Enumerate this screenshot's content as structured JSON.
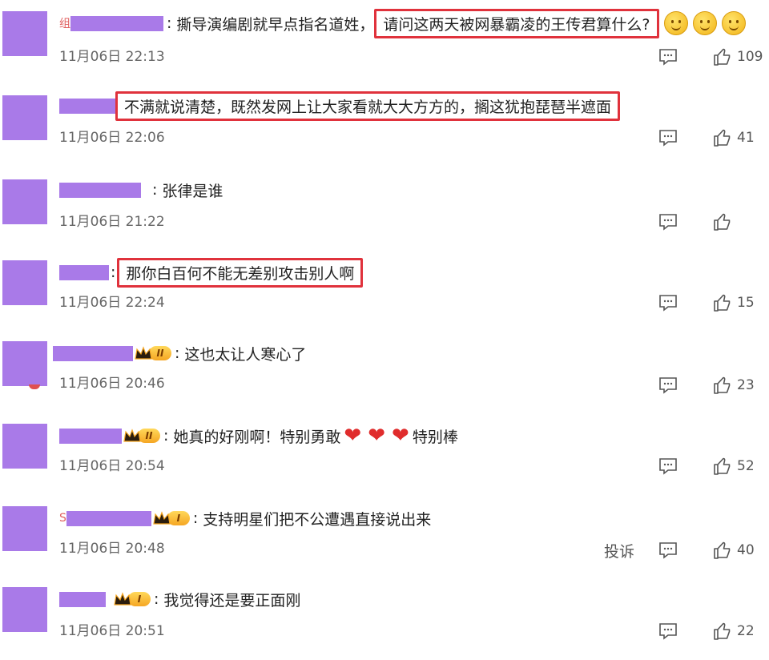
{
  "comments": [
    {
      "pre_text": "撕导演编剧就早点指名道姓，",
      "highlight_text": "请问这两天被网暴霸凌的王传君算什么?",
      "post_text": "",
      "name_fringe": "组",
      "badge_level": "",
      "time": "11月06日 22:13",
      "like_count": "109",
      "report_label": ""
    },
    {
      "pre_text": "",
      "highlight_text": "不满就说清楚，既然发网上让大家看就大大方方的，搁这犹抱琵琶半遮面",
      "post_text": "",
      "name_fringe": "",
      "badge_level": "",
      "time": "11月06日 22:06",
      "like_count": "41",
      "report_label": ""
    },
    {
      "pre_text": "张律是谁",
      "highlight_text": "",
      "post_text": "",
      "name_fringe": "",
      "badge_level": "",
      "time": "11月06日 21:22",
      "like_count": "",
      "report_label": ""
    },
    {
      "pre_text": "",
      "highlight_text": "那你白百何不能无差别攻击别人啊",
      "post_text": "",
      "name_fringe": "",
      "badge_level": "",
      "time": "11月06日 22:24",
      "like_count": "15",
      "report_label": ""
    },
    {
      "pre_text": "这也太让人寒心了",
      "highlight_text": "",
      "post_text": "",
      "name_fringe": "",
      "badge_level": "II",
      "time": "11月06日 20:46",
      "like_count": "23",
      "report_label": ""
    },
    {
      "pre_text": "她真的好刚啊！特别勇敢",
      "highlight_text": "",
      "post_text": "特别棒",
      "name_fringe": "",
      "badge_level": "II",
      "time": "11月06日 20:54",
      "like_count": "52",
      "report_label": ""
    },
    {
      "pre_text": "支持明星们把不公遭遇直接说出来",
      "highlight_text": "",
      "post_text": "",
      "name_fringe": "S",
      "badge_level": "I",
      "time": "11月06日 20:48",
      "like_count": "40",
      "report_label": "投诉"
    },
    {
      "pre_text": "我觉得还是要正面刚",
      "highlight_text": "",
      "post_text": "",
      "name_fringe": "",
      "badge_level": "I",
      "time": "11月06日 20:51",
      "like_count": "22",
      "report_label": ""
    }
  ],
  "icons": {
    "reply": "reply-icon",
    "like": "thumbs-up-icon",
    "crown": "crown-icon",
    "emoji": "smiley-emoji-icon",
    "heart": "heart-emoji-icon"
  },
  "colors": {
    "avatar_placeholder": "#a97ae8",
    "highlight_border": "#e0323c",
    "badge_gold": "#f5a623"
  }
}
